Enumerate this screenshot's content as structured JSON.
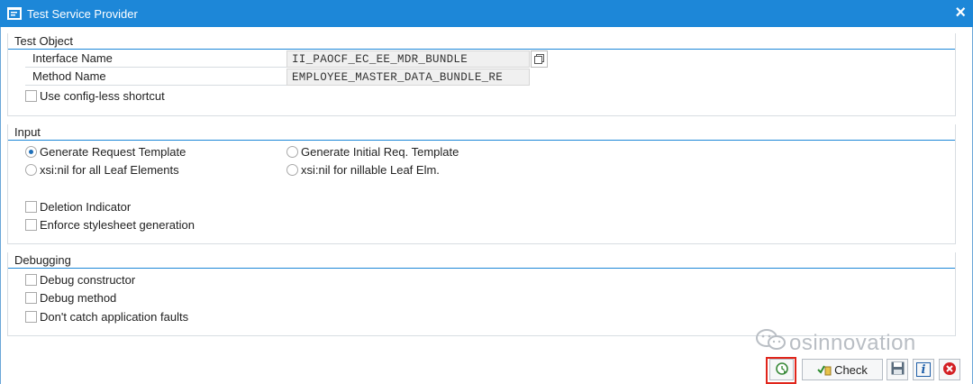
{
  "window": {
    "title": "Test Service Provider",
    "close_label": "×"
  },
  "test_object": {
    "title": "Test Object",
    "interface_name_label": "Interface Name",
    "interface_name_value": "II_PAOCF_EC_EE_MDR_BUNDLE",
    "method_name_label": "Method Name",
    "method_name_value": "EMPLOYEE_MASTER_DATA_BUNDLE_RE",
    "config_less_label": "Use config-less shortcut"
  },
  "input": {
    "title": "Input",
    "radio_generate_request": "Generate Request Template",
    "radio_generate_initial": "Generate Initial Req. Template",
    "radio_xsi_all": "xsi:nil for all Leaf Elements",
    "radio_xsi_nillable": "xsi:nil for nillable Leaf Elm.",
    "deletion_indicator": "Deletion Indicator",
    "enforce_stylesheet": "Enforce stylesheet generation"
  },
  "debugging": {
    "title": "Debugging",
    "debug_constructor": "Debug constructor",
    "debug_method": "Debug method",
    "dont_catch": "Don't catch application faults"
  },
  "watermark": {
    "text": "osinnovation"
  },
  "toolbar": {
    "check_label": "Check",
    "info_label": "i"
  }
}
